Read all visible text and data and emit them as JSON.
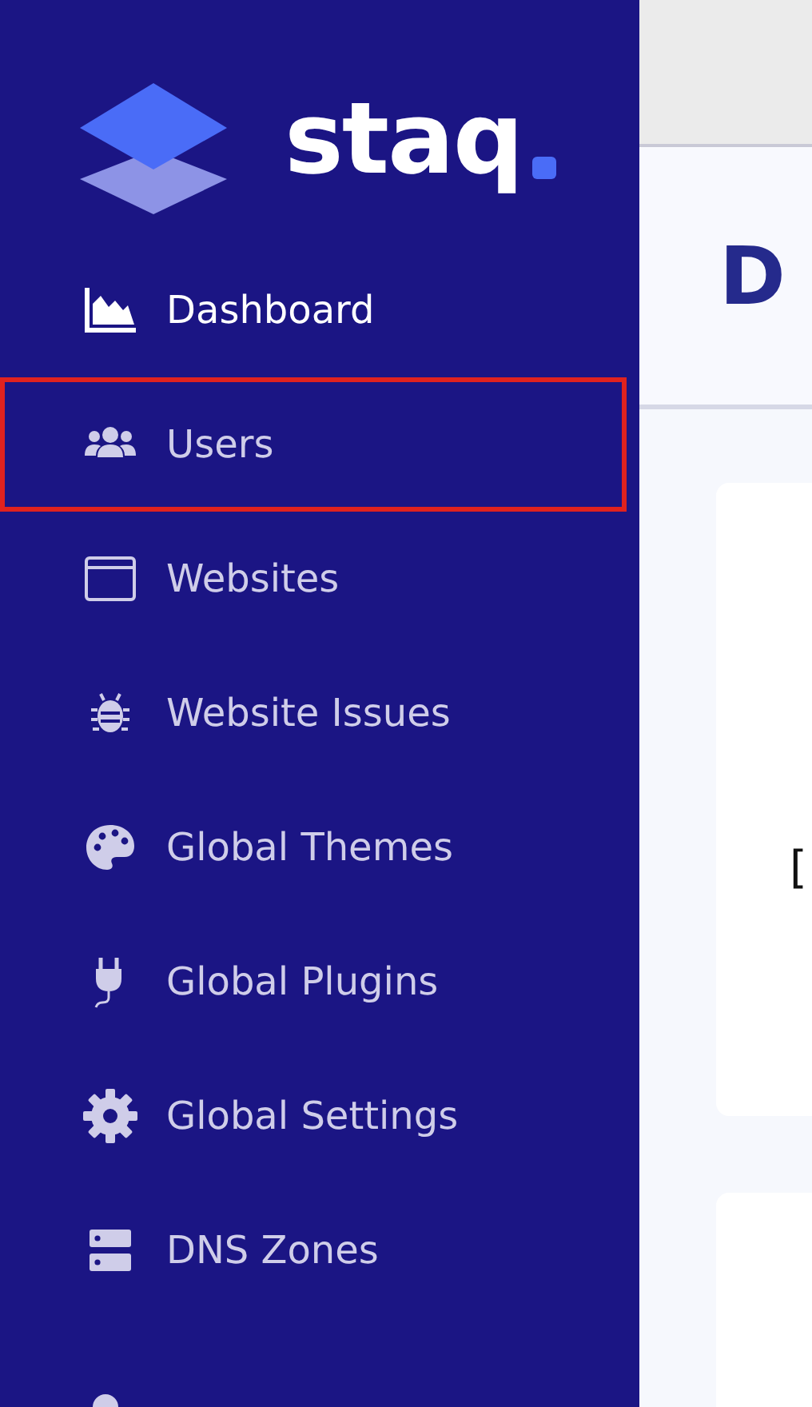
{
  "sidebar": {
    "logo": {
      "wordmark": "staq"
    },
    "items": [
      {
        "kind": "chart",
        "label": "Dashboard",
        "selected": true,
        "highlighted": false
      },
      {
        "kind": "users",
        "label": "Users",
        "selected": false,
        "highlighted": true
      },
      {
        "kind": "window",
        "label": "Websites",
        "selected": false,
        "highlighted": false
      },
      {
        "kind": "bug",
        "label": "Website Issues",
        "selected": false,
        "highlighted": false
      },
      {
        "kind": "palette",
        "label": "Global Themes",
        "selected": false,
        "highlighted": false
      },
      {
        "kind": "plug",
        "label": "Global Plugins",
        "selected": false,
        "highlighted": false
      },
      {
        "kind": "gear",
        "label": "Global Settings",
        "selected": false,
        "highlighted": false
      },
      {
        "kind": "server",
        "label": "DNS Zones",
        "selected": false,
        "highlighted": false
      }
    ]
  },
  "header": {
    "title": "D"
  },
  "card": {
    "text": "["
  }
}
